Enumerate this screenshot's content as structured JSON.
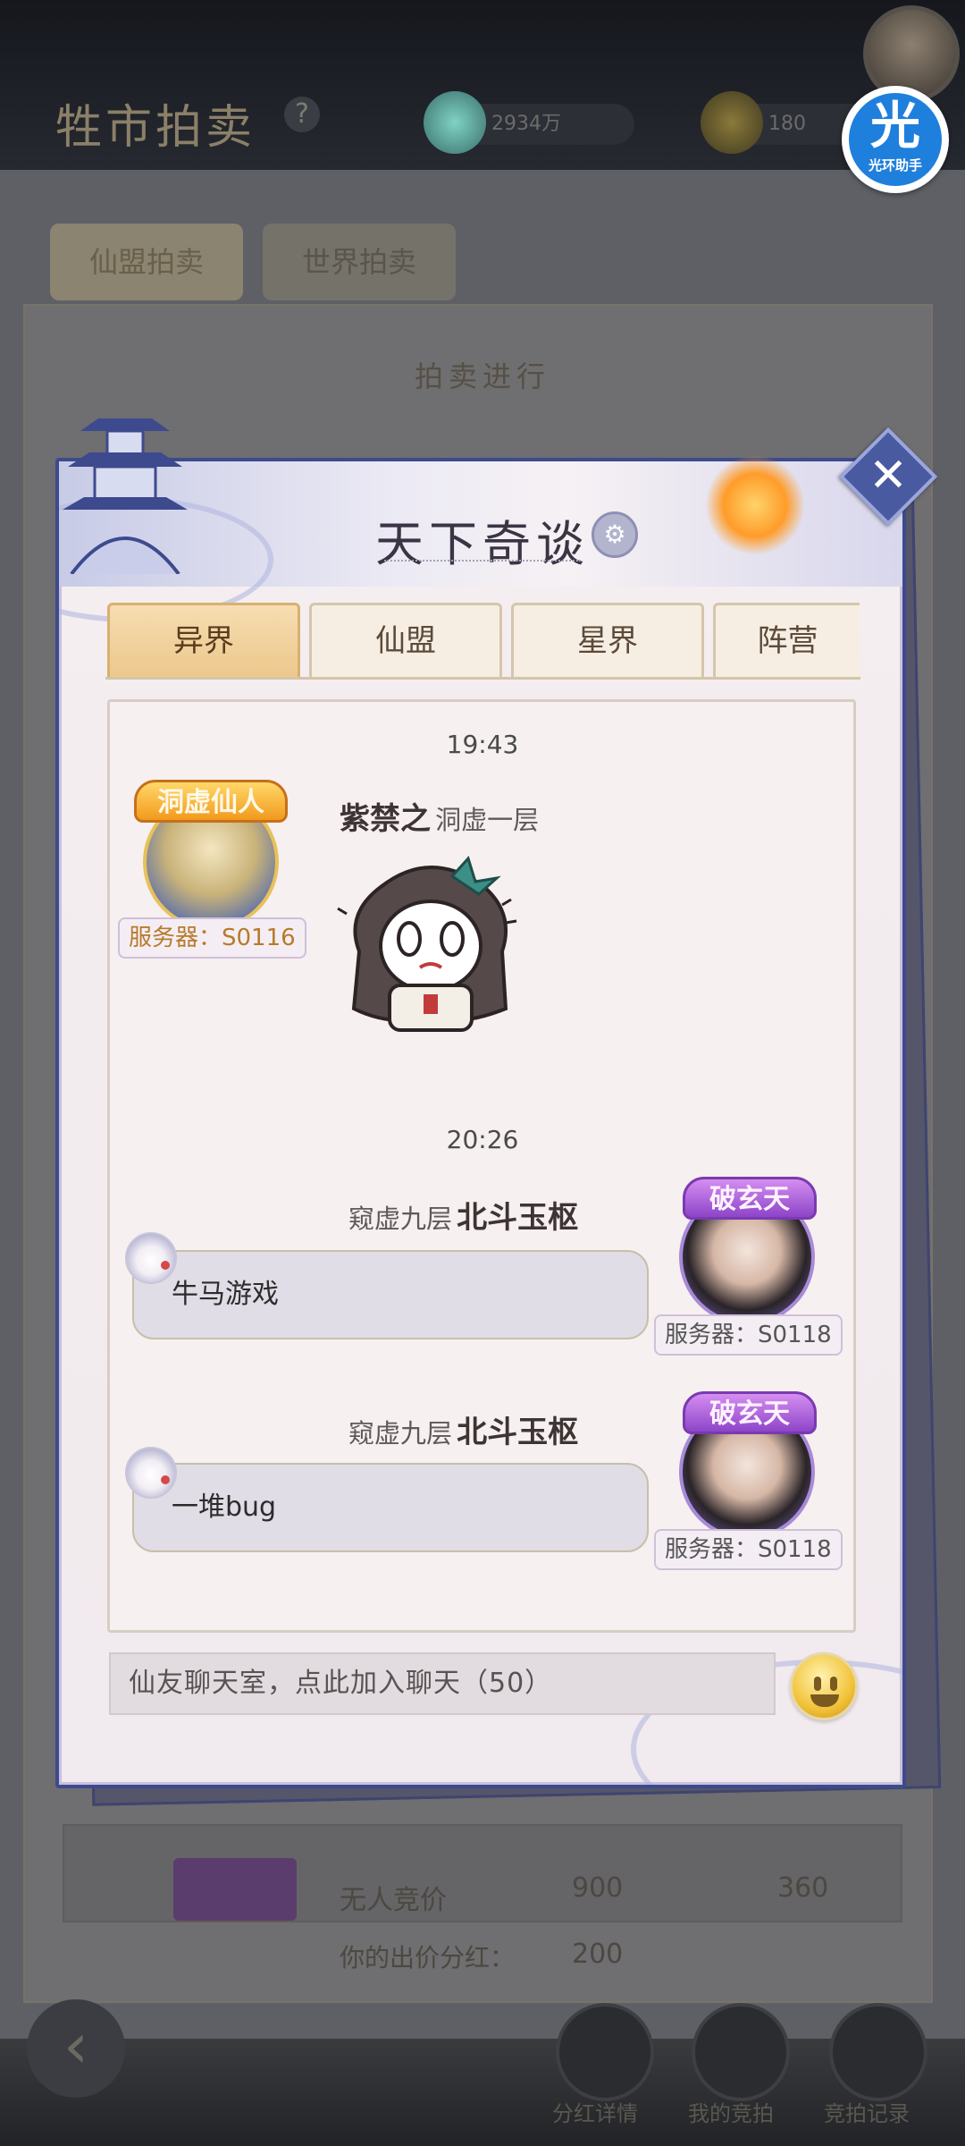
{
  "background": {
    "title": "牲市拍卖",
    "help": "?",
    "currency_value": "2934万",
    "currency2_value": "180",
    "tabs": [
      "仙盟拍卖",
      "世界拍卖"
    ],
    "panel_title": "拍卖进行",
    "item_name": "无人竞价",
    "price1": "900",
    "price2": "360",
    "bid_label": "你的出价分红：",
    "bid_value": "200",
    "bottom_buttons": [
      "分红详情",
      "我的竞拍",
      "竞拍记录"
    ]
  },
  "assistant": {
    "glyph": "光",
    "label": "光环助手"
  },
  "popup": {
    "title": "天下奇谈",
    "close": "✕",
    "tabs": [
      {
        "label": "异界",
        "active": true
      },
      {
        "label": "仙盟",
        "active": false
      },
      {
        "label": "星界",
        "active": false
      },
      {
        "label": "阵营",
        "active": false
      }
    ]
  },
  "chat": {
    "messages": [
      {
        "time": "19:43",
        "crest": "洞虚仙人",
        "server": "服务器：S0116",
        "name": "紫禁之",
        "rank": "洞虚一层",
        "content_type": "sticker"
      },
      {
        "time": "20:26",
        "crest": "破玄天",
        "server": "服务器：S0118",
        "rank": "窥虚九层",
        "name": "北斗玉枢",
        "text": "牛马游戏"
      },
      {
        "crest": "破玄天",
        "server": "服务器：S0118",
        "rank": "窥虚九层",
        "name": "北斗玉枢",
        "text": "一堆bug"
      }
    ],
    "input_placeholder": "仙友聊天室，点此加入聊天（50）"
  },
  "colors": {
    "accent_blue": "#3d4b8c",
    "tab_active": "#ecc88c",
    "bubble": "#e0dde6"
  },
  "icons": [
    "close-icon",
    "emoji-icon",
    "back-arrow-icon",
    "settings-gear-icon"
  ]
}
